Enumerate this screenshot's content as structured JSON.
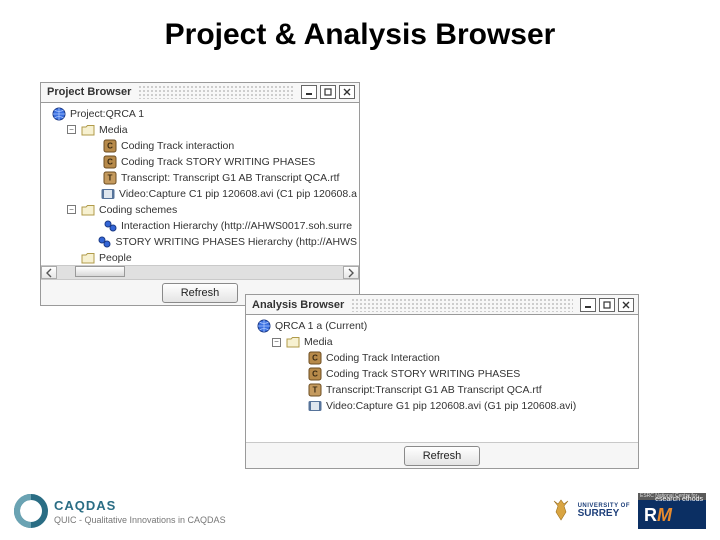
{
  "slide": {
    "title": "Project & Analysis Browser"
  },
  "project_panel": {
    "title": "Project Browser",
    "refresh": "Refresh",
    "root": "Project:QRCA 1",
    "media": {
      "label": "Media",
      "items": [
        "Coding Track interaction",
        "Coding Track STORY WRITING PHASES",
        "Transcript: Transcript G1 AB Transcript QCA.rtf",
        "Video:Capture C1 pip 120608.avi (C1 pip 120608.a"
      ]
    },
    "coding": {
      "label": "Coding schemes",
      "items": [
        "Interaction   Hierarchy (http://AHWS0017.soh.surre",
        "STORY WRITING PHASES   Hierarchy (http://AHWS"
      ]
    },
    "people": "People"
  },
  "analysis_panel": {
    "title": "Analysis Browser",
    "refresh": "Refresh",
    "root": "QRCA 1 a (Current)",
    "media": {
      "label": "Media",
      "items": [
        "Coding Track Interaction",
        "Coding Track STORY WRITING PHASES",
        "Transcript:Transcript G1 AB Transcript QCA.rtf",
        "Video:Capture G1 pip 120608.avi (G1 pip 120608.avi)"
      ]
    }
  },
  "footer": {
    "caqdas": "CAQDAS",
    "quic": "QUIC - Qualitative Innovations in CAQDAS",
    "surrey_top": "UNIVERSITY OF",
    "surrey": "SURREY",
    "nrm_top": "ESRC National Centre for",
    "nrm_side": "esearch\nethods"
  }
}
